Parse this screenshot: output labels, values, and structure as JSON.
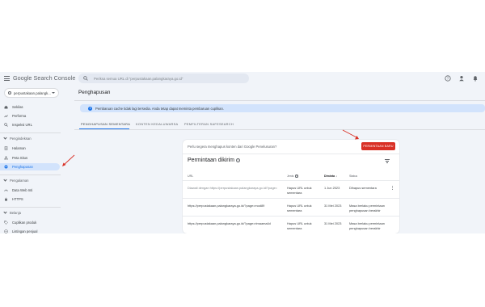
{
  "header": {
    "logo_google": "Google",
    "logo_product": "Search Console",
    "search_placeholder": "Periksa semua URL di \"perpustakaan.palangkaraya.go.id\""
  },
  "sidebar": {
    "property": "perpustakaan.palangk...",
    "top_items": [
      {
        "label": "Sekilas"
      },
      {
        "label": "Performa"
      },
      {
        "label": "Inspeksi URL"
      }
    ],
    "sections": [
      {
        "label": "Pengindeksan",
        "items": [
          {
            "label": "Halaman"
          },
          {
            "label": "Peta Situs"
          },
          {
            "label": "Penghapusan"
          }
        ]
      },
      {
        "label": "Pengalaman",
        "items": [
          {
            "label": "Data Web Inti"
          },
          {
            "label": "HTTPS"
          }
        ]
      },
      {
        "label": "Belanja",
        "items": [
          {
            "label": "Cuplikan produk"
          },
          {
            "label": "Listingan penjual"
          }
        ]
      }
    ]
  },
  "main": {
    "title": "Penghapusan",
    "info": "Pembaruan cache tidak lagi tersedia. Anda tetap dapat meminta pembaruan cuplikan.",
    "tabs": [
      "PENGHAPUSAN SEMENTARA",
      "KONTEN KEDALUWARSA",
      "PEMFILTERAN SAFESEARCH"
    ],
    "card": {
      "prompt": "Perlu segera menghapus konten dari Google Penelusuran?",
      "new_button": "PERMINTAAN BARU",
      "section_title": "Permintaan dikirim",
      "columns": {
        "url": "URL",
        "type": "Jenis",
        "date": "Diminta",
        "status": "Status"
      },
      "rows": [
        {
          "url": "Diawali dengan https://perpustakaan.palangkaraya.go.id/?page=",
          "type": "Hapus URL untuk sementara",
          "date": "1 Jun 2023",
          "status": "Dihapus sementara"
        },
        {
          "url": "https://perpustakaan.palangkaraya.go.id/?page=mod89",
          "type": "Hapus URL untuk sementara",
          "date": "31 Mei 2023",
          "status": "Masa berlaku permintaan penghapusan berakhir"
        },
        {
          "url": "https://perpustakaan.palangkaraya.go.id/?page=rimaama4d",
          "type": "Hapus URL untuk sementara",
          "date": "31 Mei 2023",
          "status": "Masa berlaku permintaan penghapusan berakhir"
        }
      ]
    }
  },
  "colors": {
    "accent": "#1a73e8",
    "danger": "#d93025",
    "active_nav_bg": "#d2e3fc",
    "app_bg": "#f1f4f9"
  },
  "icons": [
    "menu-icon",
    "search-icon",
    "help-icon",
    "account-icon",
    "bell-icon",
    "filter-icon",
    "more-vert-icon",
    "info-icon"
  ]
}
